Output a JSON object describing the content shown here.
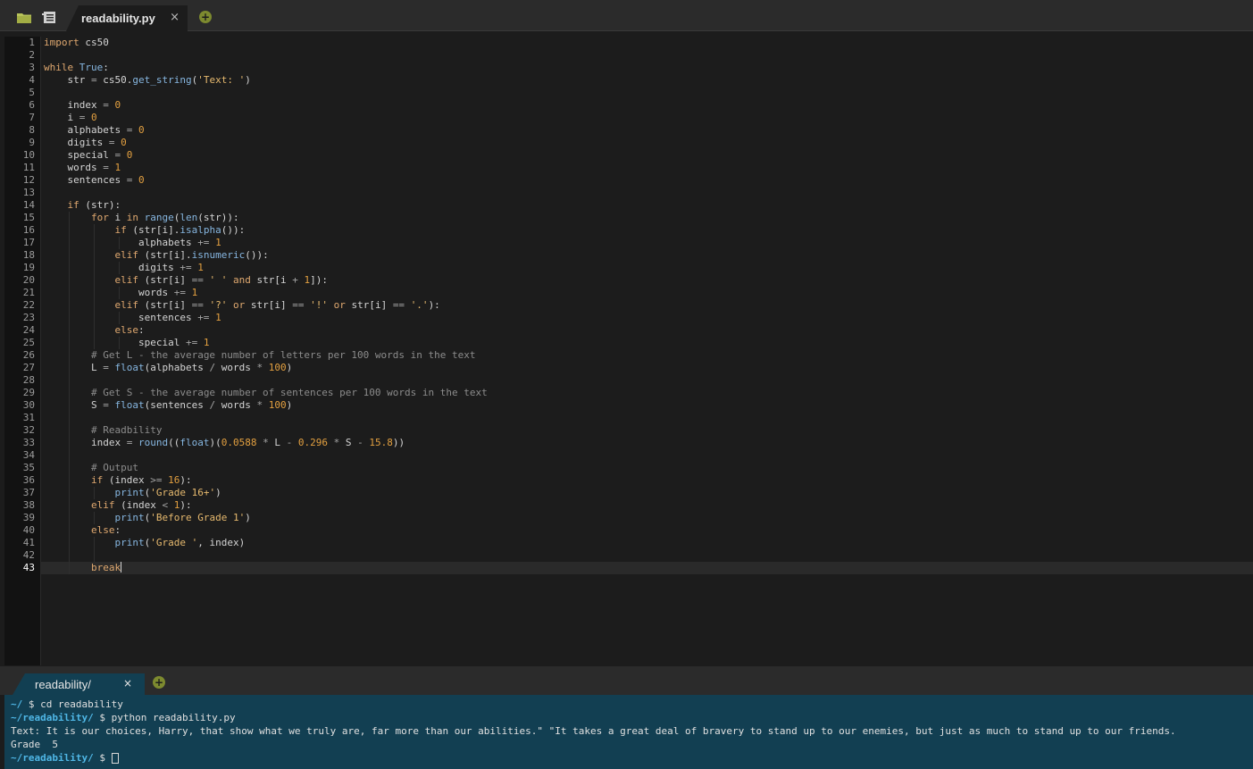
{
  "editor": {
    "tab": {
      "title": "readability.py",
      "close": "×"
    },
    "new_tab": "+",
    "line_numbers": [
      "1",
      "2",
      "3",
      "4",
      "5",
      "6",
      "7",
      "8",
      "9",
      "10",
      "11",
      "12",
      "13",
      "14",
      "15",
      "16",
      "17",
      "18",
      "19",
      "20",
      "21",
      "22",
      "23",
      "24",
      "25",
      "26",
      "27",
      "28",
      "29",
      "30",
      "31",
      "32",
      "33",
      "34",
      "35",
      "36",
      "37",
      "38",
      "39",
      "40",
      "41",
      "42",
      "43"
    ],
    "active_line": 43,
    "code": [
      "import cs50",
      "",
      "while True:",
      "    str = cs50.get_string('Text: ')",
      "",
      "    index = 0",
      "    i = 0",
      "    alphabets = 0",
      "    digits = 0",
      "    special = 0",
      "    words = 1",
      "    sentences = 0",
      "",
      "    if (str):",
      "        for i in range(len(str)):",
      "            if (str[i].isalpha()):",
      "                alphabets += 1",
      "            elif (str[i].isnumeric()):",
      "                digits += 1",
      "            elif (str[i] == ' ' and str[i + 1]):",
      "                words += 1",
      "            elif (str[i] == '?' or str[i] == '!' or str[i] == '.'):",
      "                sentences += 1",
      "            else:",
      "                special += 1",
      "        # Get L - the average number of letters per 100 words in the text",
      "        L = float(alphabets / words * 100)",
      "",
      "        # Get S - the average number of sentences per 100 words in the text",
      "        S = float(sentences / words * 100)",
      "",
      "        # Readbility",
      "        index = round((float)(0.0588 * L - 0.296 * S - 15.8))",
      "",
      "        # Output",
      "        if (index >= 16):",
      "            print('Grade 16+')",
      "        elif (index < 1):",
      "            print('Before Grade 1')",
      "        else:",
      "            print('Grade ', index)",
      "",
      "        break"
    ]
  },
  "terminal": {
    "tab": {
      "title": "readability/",
      "close": "×"
    },
    "new_tab": "+",
    "lines": [
      {
        "dir": "~/",
        "text": " $ cd readability"
      },
      {
        "dir": "~/readability/",
        "text": " $ python readability.py"
      },
      {
        "dir": "",
        "text": "Text: It is our choices, Harry, that show what we truly are, far more than our abilities.\" \"It takes a great deal of bravery to stand up to our enemies, but just as much to stand up to our friends."
      },
      {
        "dir": "",
        "text": "Grade  5"
      },
      {
        "dir": "~/readability/",
        "text": " $ "
      }
    ]
  }
}
